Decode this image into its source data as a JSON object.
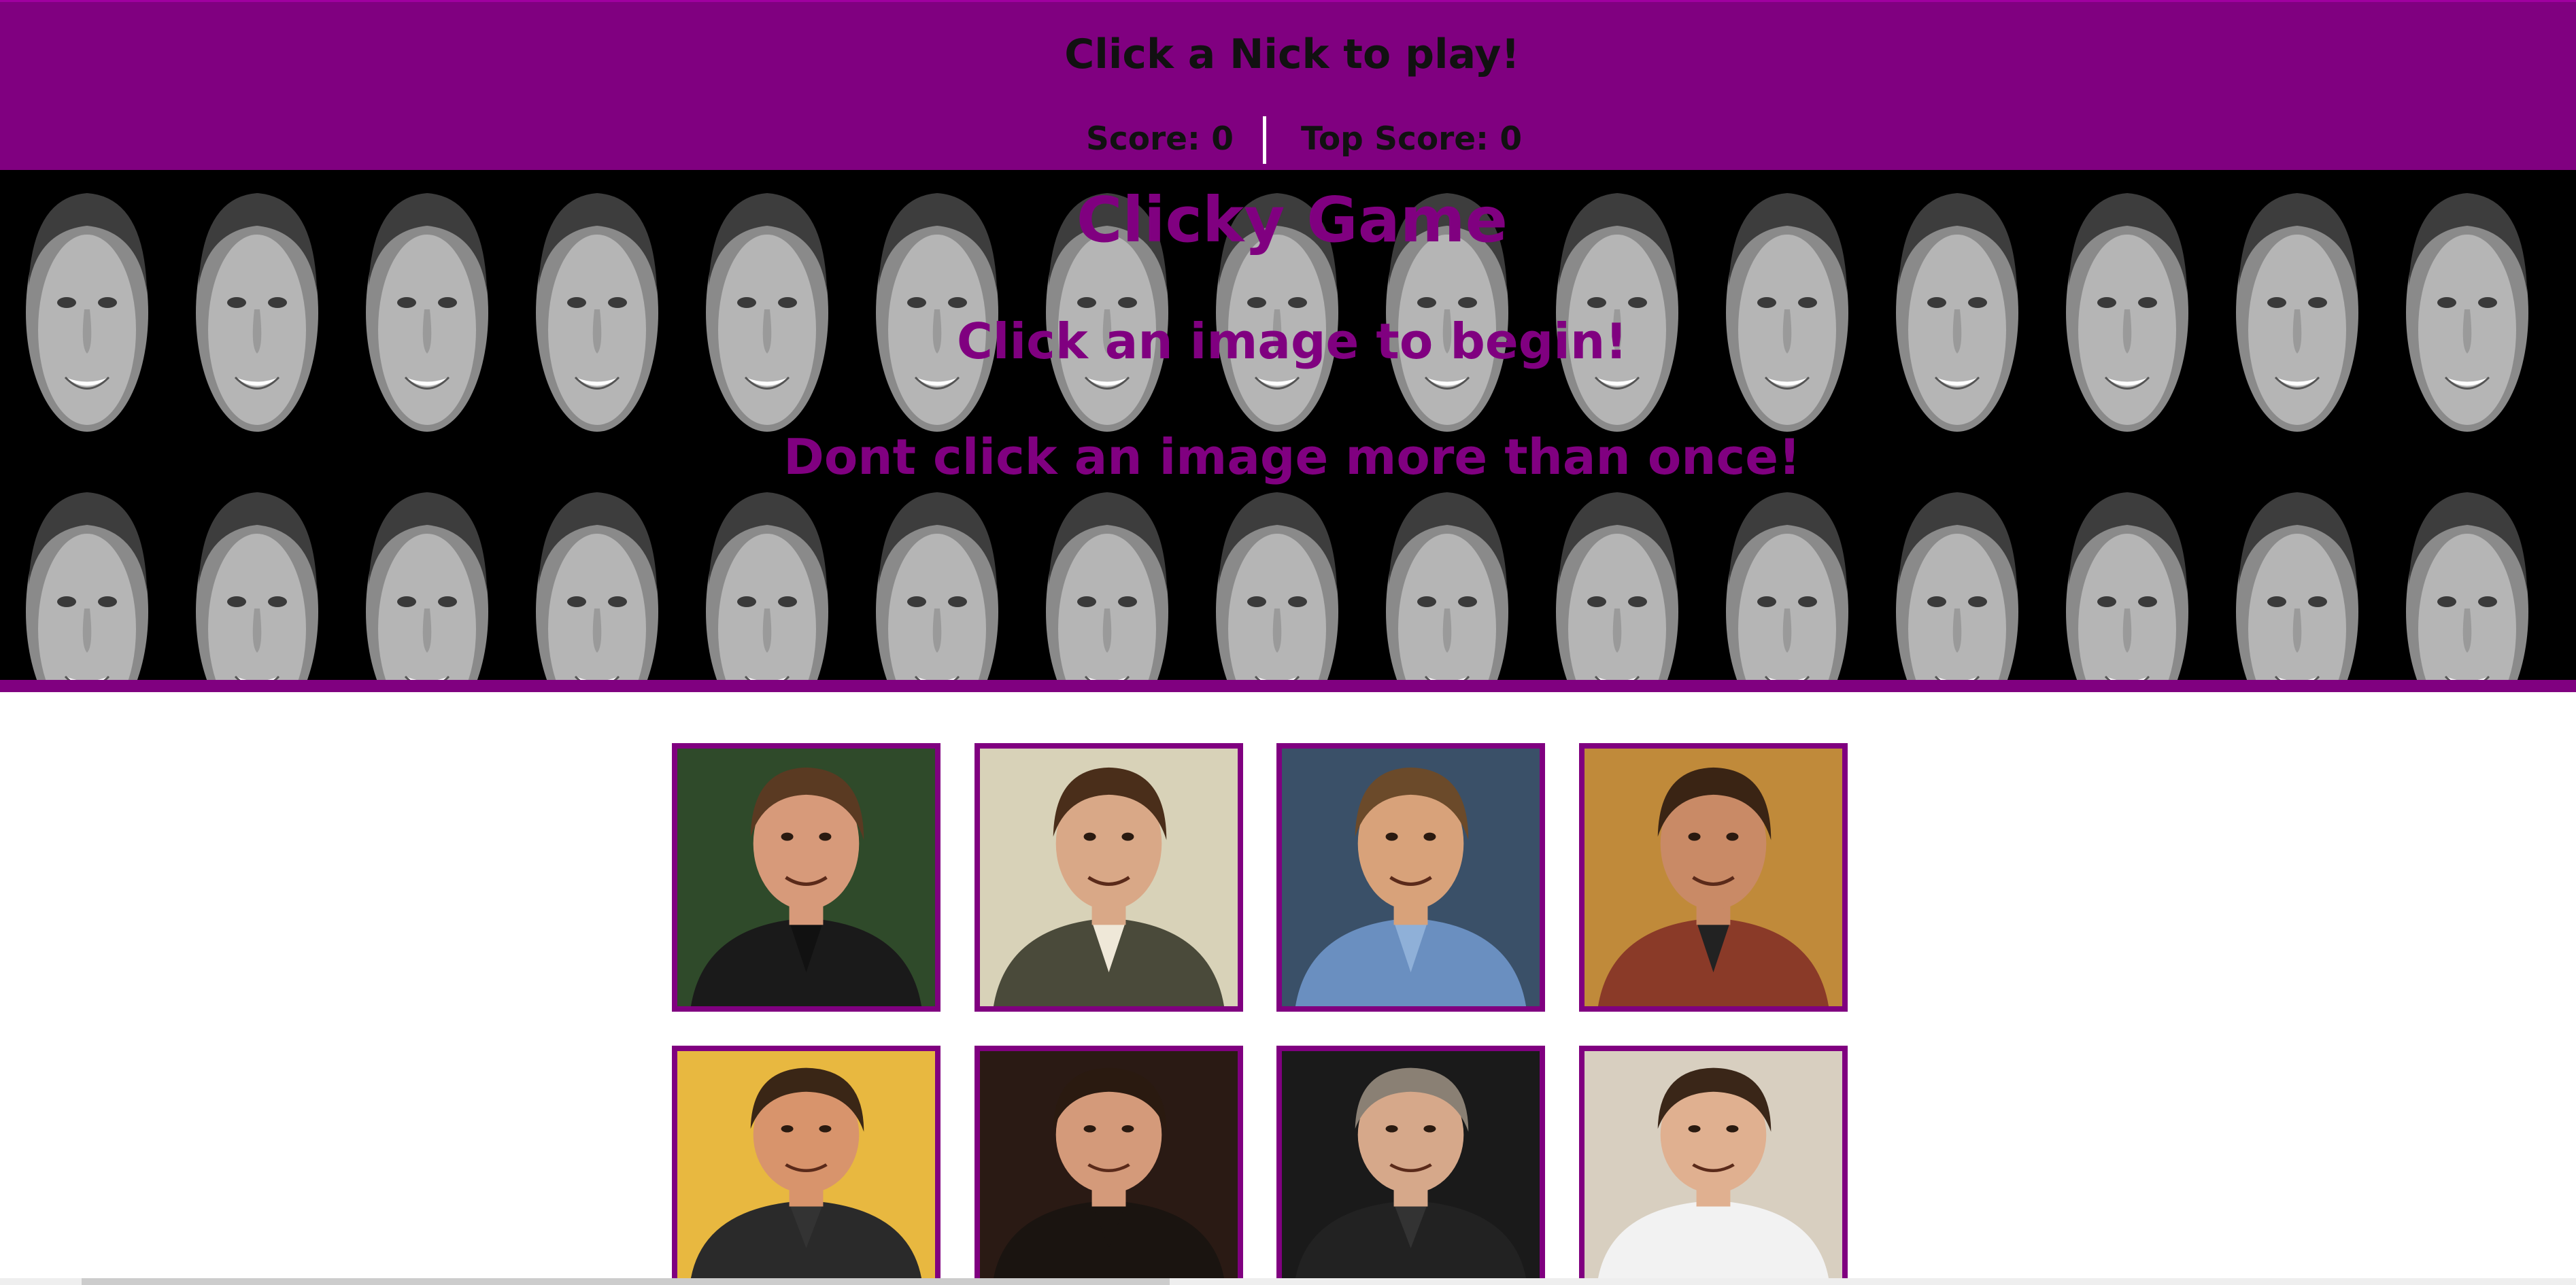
{
  "navbar": {
    "prompt": "Click a Nick to play!",
    "score_label": "Score: 0",
    "top_score_label": "Top Score: 0",
    "background_color": "#800080"
  },
  "hero": {
    "title": "Clicky Game",
    "line1": "Click an image to begin!",
    "line2": "Dont click an image more than once!",
    "text_color": "#800080",
    "background_pattern": "repeating-face-icons"
  },
  "cards": [
    {
      "name": "nick-photo-1",
      "bg": "#2f4a2a",
      "skin": "#d79a7a",
      "hair": "#5a3a22",
      "suit": "#1a1a1a",
      "shirt": "#111111"
    },
    {
      "name": "nick-photo-2",
      "bg": "#d8d2b8",
      "skin": "#d9a887",
      "hair": "#4a2e1a",
      "suit": "#4a4a3a",
      "shirt": "#efe8d8"
    },
    {
      "name": "nick-photo-3",
      "bg": "#3a5068",
      "skin": "#d8a27a",
      "hair": "#6b4a2a",
      "suit": "#6a8fc0",
      "shirt": "#8fb0d8"
    },
    {
      "name": "nick-photo-4",
      "bg": "#c08a3a",
      "skin": "#c98a66",
      "hair": "#3a2414",
      "suit": "#8a3a28",
      "shirt": "#222222"
    },
    {
      "name": "nick-photo-5",
      "bg": "#e8b840",
      "skin": "#d8946c",
      "hair": "#3a2616",
      "suit": "#2a2a2a",
      "shirt": "#333333"
    },
    {
      "name": "nick-photo-6",
      "bg": "#2a1a14",
      "skin": "#d49a7a",
      "hair": "#2a1a10",
      "suit": "#1a1410",
      "shirt": "#1a1410"
    },
    {
      "name": "nick-photo-7",
      "bg": "#1a1a1a",
      "skin": "#d6a88a",
      "hair": "#8a8074",
      "suit": "#222222",
      "shirt": "#333333"
    },
    {
      "name": "nick-photo-8",
      "bg": "#d8cfc0",
      "skin": "#e0b090",
      "hair": "#3a2618",
      "suit": "#f2f2f2",
      "shirt": "#f2f2f2"
    }
  ]
}
